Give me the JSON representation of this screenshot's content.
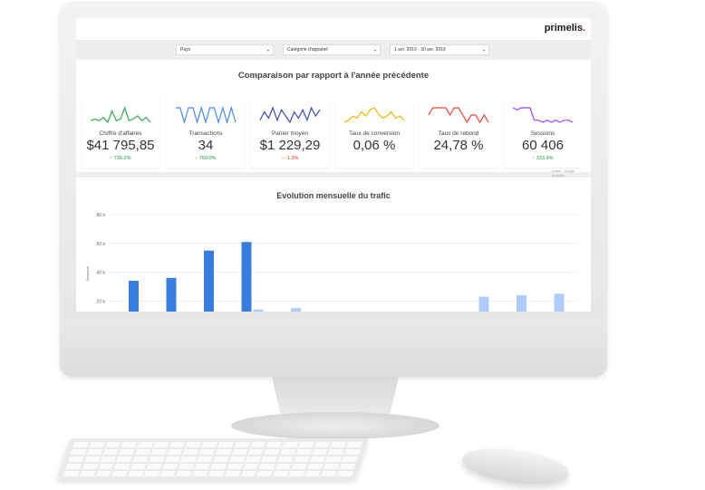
{
  "brand": {
    "name": "primelis",
    "dot": "."
  },
  "filters": [
    {
      "label": "Pays"
    },
    {
      "label": "Catégorie d'appareil"
    },
    {
      "label": "1 avr. 2019 - 30 avr. 2019"
    }
  ],
  "section_title": "Comparaison par rapport à l'année précédente",
  "kpis": [
    {
      "label": "Chiffre d'affaires",
      "value": "$41 795,85",
      "change": "739.2%",
      "direction": "up",
      "color": "#34a853",
      "spark": [
        4,
        5,
        4,
        6,
        3,
        10,
        4,
        5,
        12,
        4,
        5,
        7,
        4,
        6,
        3
      ]
    },
    {
      "label": "Transactions",
      "value": "34",
      "change": "750.0%",
      "direction": "up",
      "color": "#4a86e8",
      "spark": [
        6,
        6,
        5,
        6,
        6,
        5,
        6,
        5,
        6,
        6,
        5,
        6,
        5,
        6,
        5
      ]
    },
    {
      "label": "Panier moyen",
      "value": "$1 229,29",
      "change": "-1.3%",
      "direction": "down",
      "color": "#3c4bb5",
      "spark": [
        4,
        8,
        5,
        10,
        4,
        9,
        6,
        3,
        8,
        5,
        9,
        4,
        10,
        6,
        9
      ]
    },
    {
      "label": "Taux de conversion",
      "value": "0,06 %",
      "change": "",
      "direction": "",
      "color": "#f4b400",
      "spark": [
        3,
        4,
        6,
        5,
        8,
        6,
        9,
        10,
        7,
        5,
        6,
        8,
        5,
        6,
        4
      ]
    },
    {
      "label": "Taux de rebond",
      "value": "24,78 %",
      "change": "",
      "direction": "",
      "color": "#ea4335",
      "spark": [
        8,
        9,
        9,
        9,
        9,
        8,
        9,
        9,
        8,
        7,
        8,
        8,
        7,
        8,
        7
      ]
    },
    {
      "label": "Sessions",
      "value": "60 406",
      "change": "333.9%",
      "direction": "up",
      "color": "#a142f4",
      "spark": [
        10,
        9,
        10,
        10,
        10,
        4,
        4,
        3,
        4,
        3,
        4,
        3,
        4,
        4,
        3
      ]
    }
  ],
  "source_note": "source : Google Analytics",
  "chart_data": {
    "type": "bar",
    "title": "Evolution mensuelle du trafic",
    "ylabel": "Sessions",
    "ylim": [
      0,
      80000
    ],
    "yticks": [
      "80 k",
      "60 k",
      "40 k",
      "20 k"
    ],
    "series": [
      {
        "color": "#3a7de0",
        "values": [
          34000,
          36000,
          55000,
          61000,
          0,
          0,
          0,
          0,
          0,
          0,
          0,
          0
        ]
      },
      {
        "color": "#aecbfa",
        "values": [
          11000,
          12000,
          12000,
          14000,
          15000,
          4000,
          1000,
          1000,
          11000,
          23000,
          24000,
          25000
        ]
      }
    ]
  }
}
